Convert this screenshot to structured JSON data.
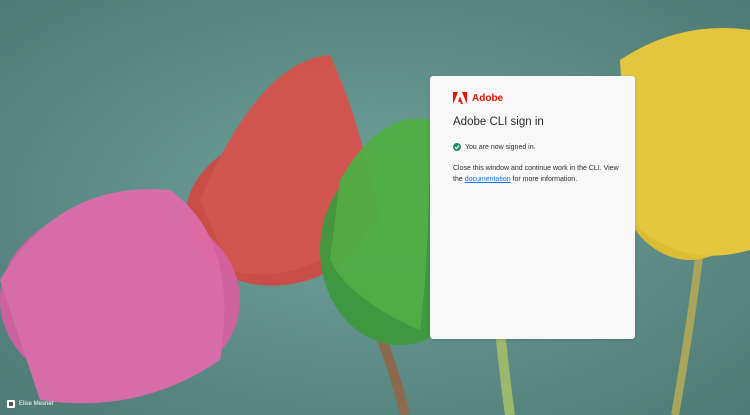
{
  "brand": {
    "name": "Adobe",
    "color": "#eb1000"
  },
  "card": {
    "title": "Adobe CLI sign in",
    "status_text": "You are now signed in.",
    "message_prefix": "Close this window and continue work in the CLI. View the ",
    "link_text": "documentation",
    "message_suffix": " for more information."
  },
  "photo_credit": {
    "name": "Elise Mesner"
  },
  "colors": {
    "success": "#268e6c",
    "link": "#1473e6",
    "background": "#5d8a84"
  },
  "icons": {
    "logo": "adobe-logo-icon",
    "status": "checkmark-circle-icon",
    "credit": "photo-credit-icon"
  }
}
